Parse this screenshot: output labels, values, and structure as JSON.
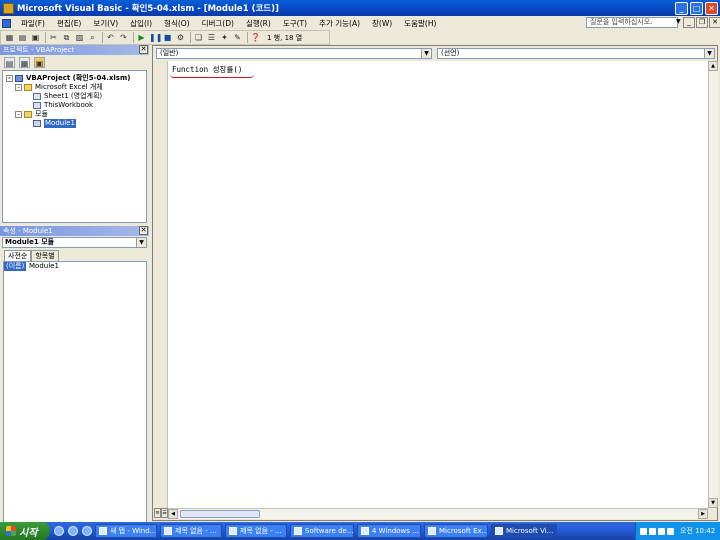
{
  "window": {
    "title": "Microsoft Visual Basic - 확인5-04.xlsm - [Module1 (코드)]",
    "controls": {
      "minimize": "_",
      "maximize": "□",
      "close": "✕"
    }
  },
  "menu": {
    "items": [
      "파일(F)",
      "편집(E)",
      "보기(V)",
      "삽입(I)",
      "형식(O)",
      "디버그(D)",
      "실행(R)",
      "도구(T)",
      "추가 기능(A)",
      "창(W)",
      "도움말(H)"
    ],
    "help_placeholder": "질문을 입력하십시오."
  },
  "toolbar": {
    "icons": [
      "excel-view-icon",
      "insert-module-icon",
      "save-icon",
      "cut-icon",
      "copy-icon",
      "paste-icon",
      "find-icon",
      "undo-icon",
      "redo-icon",
      "run-icon",
      "break-icon",
      "reset-icon",
      "design-mode-icon",
      "project-explorer-icon",
      "properties-icon",
      "object-browser-icon",
      "toolbox-icon",
      "help-icon"
    ],
    "cursor_position": "1 행, 18 열"
  },
  "project_pane": {
    "title": "프로젝트 - VBAProject",
    "tree": [
      {
        "level": 0,
        "label": "VBAProject (확인5-04.xlsm)",
        "icon": "project",
        "expander": "-"
      },
      {
        "level": 1,
        "label": "Microsoft Excel 개체",
        "icon": "folder",
        "expander": "-"
      },
      {
        "level": 2,
        "label": "Sheet1 (영업계획)",
        "icon": "sheet",
        "expander": ""
      },
      {
        "level": 2,
        "label": "ThisWorkbook",
        "icon": "sheet",
        "expander": ""
      },
      {
        "level": 1,
        "label": "모듈",
        "icon": "folder",
        "expander": "-"
      },
      {
        "level": 2,
        "label": "Module1",
        "icon": "module",
        "expander": ""
      }
    ]
  },
  "properties_pane": {
    "title": "속성 - Module1",
    "object_select": "Module1 모듈",
    "tabs": [
      "사전순",
      "항목별"
    ],
    "rows": [
      {
        "key": "(이름)",
        "value": "Module1"
      }
    ]
  },
  "code_window": {
    "object_combo": "(일반)",
    "procedure_combo": "(선언)",
    "code_line": "Function 성장률()"
  },
  "taskbar": {
    "start_label": "시작",
    "buttons": [
      {
        "label": "새 탭 - Wind...",
        "active": false
      },
      {
        "label": "제목 없음 - ...",
        "active": false
      },
      {
        "label": "제목 없음 - ...",
        "active": false
      },
      {
        "label": "Software de...",
        "active": false
      },
      {
        "label": "4 Windows ...",
        "active": false
      },
      {
        "label": "Microsoft Ex...",
        "active": false
      },
      {
        "label": "Microsoft Vi...",
        "active": true
      }
    ],
    "clock": "오전 10:42"
  }
}
